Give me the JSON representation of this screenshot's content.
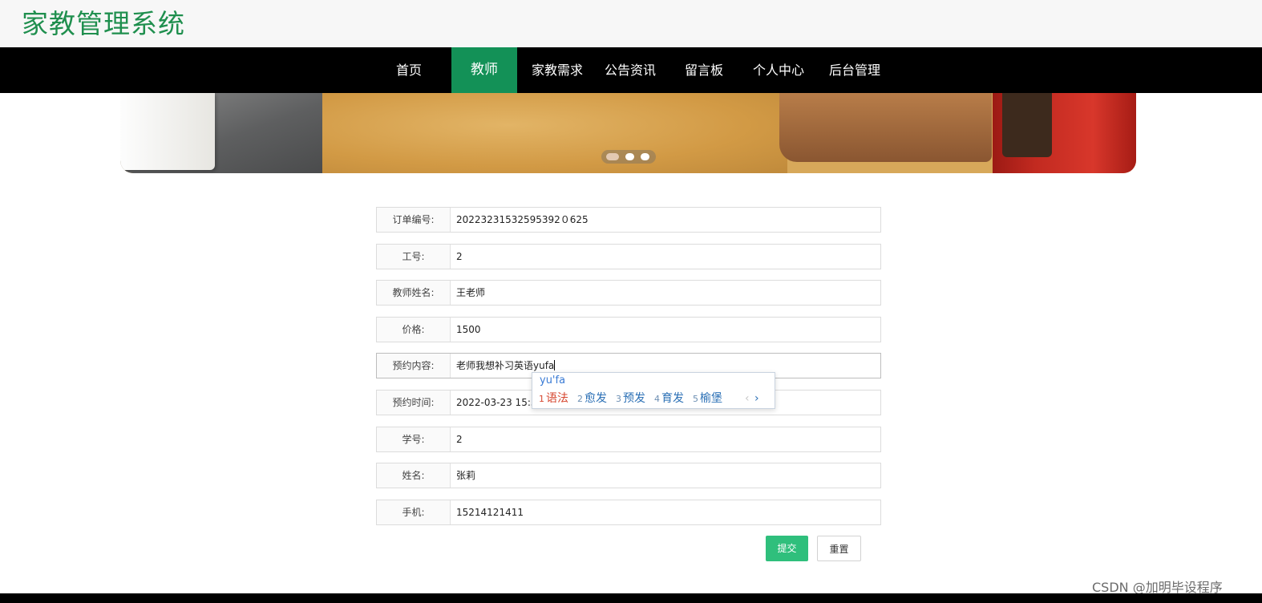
{
  "header": {
    "title": "家教管理系统"
  },
  "nav": {
    "items": [
      {
        "label": "首页"
      },
      {
        "label": "教师",
        "active": true
      },
      {
        "label": "家教需求"
      },
      {
        "label": "公告资讯"
      },
      {
        "label": "留言板"
      },
      {
        "label": "个人中心"
      },
      {
        "label": "后台管理"
      }
    ]
  },
  "carousel": {
    "slide_count": 3,
    "active_index": 0
  },
  "form": {
    "fields": [
      {
        "label": "订单编号:",
        "value": "20223231532595392０625"
      },
      {
        "label": "工号:",
        "value": "2"
      },
      {
        "label": "教师姓名:",
        "value": "王老师"
      },
      {
        "label": "价格:",
        "value": "1500"
      },
      {
        "label": "预约内容:",
        "value": "老师我想补习英语yufa"
      },
      {
        "label": "预约时间:",
        "value": "2022-03-23 15:32:"
      },
      {
        "label": "学号:",
        "value": "2"
      },
      {
        "label": "姓名:",
        "value": "张莉"
      },
      {
        "label": "手机:",
        "value": "15214121411"
      }
    ],
    "submit_label": "提交",
    "reset_label": "重置"
  },
  "ime": {
    "pinyin": "yu'fa",
    "candidates": [
      {
        "num": "1",
        "text": "语法"
      },
      {
        "num": "2",
        "text": "愈发"
      },
      {
        "num": "3",
        "text": "预发"
      },
      {
        "num": "4",
        "text": "育发"
      },
      {
        "num": "5",
        "text": "榆堡"
      }
    ],
    "prev": "‹",
    "next": "›"
  },
  "watermark": "CSDN @加明毕设程序",
  "colors": {
    "brand_green": "#1f8f4e",
    "nav_active": "#139157",
    "submit": "#2fbf7c",
    "nav_bg": "#000000"
  }
}
